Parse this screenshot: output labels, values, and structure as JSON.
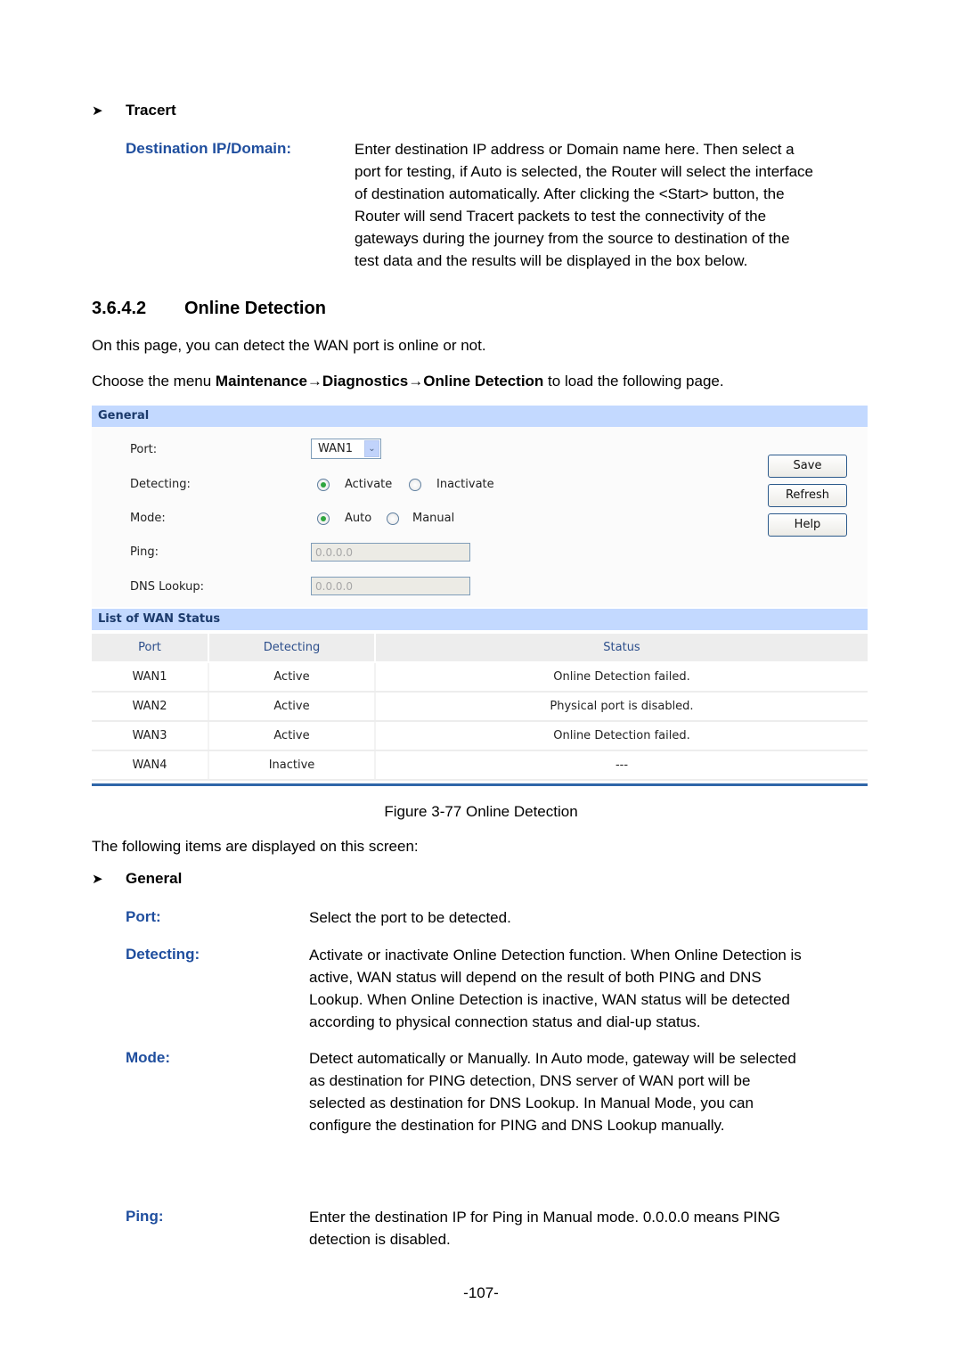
{
  "tracert": {
    "bullet": "Tracert",
    "items": [
      {
        "term": "Destination IP/Domain:",
        "lines": [
          "Enter destination IP address or Domain name here. Then select a",
          "port for testing, if Auto is selected, the Router will select the interface",
          "of destination automatically. After clicking the <Start> button, the",
          "Router will send Tracert packets to test the connectivity of the",
          "gateways during the journey from the source to destination of the",
          "test data and the results will be displayed in the box below."
        ]
      }
    ]
  },
  "section": {
    "number": "3.6.4.2",
    "title": "Online Detection",
    "intro": "On this page, you can detect the WAN port is online or not.",
    "menu_prefix": "Choose the menu ",
    "menu_path": "Maintenance→Diagnostics→Online Detection",
    "menu_suffix": " to load the following page."
  },
  "ui": {
    "general_title": "General",
    "fields": {
      "port_label": "Port:",
      "port_value": "WAN1",
      "detecting_label": "Detecting:",
      "detecting_options": [
        "Activate",
        "Inactivate"
      ],
      "detecting_selected": "Activate",
      "mode_label": "Mode:",
      "mode_options": [
        "Auto",
        "Manual"
      ],
      "mode_selected": "Auto",
      "ping_label": "Ping:",
      "ping_value": "0.0.0.0",
      "dns_label": "DNS Lookup:",
      "dns_value": "0.0.0.0"
    },
    "buttons": {
      "save": "Save",
      "refresh": "Refresh",
      "help": "Help"
    },
    "list_title": "List of WAN Status",
    "table": {
      "headers": [
        "Port",
        "Detecting",
        "Status"
      ],
      "rows": [
        [
          "WAN1",
          "Active",
          "Online Detection failed."
        ],
        [
          "WAN2",
          "Active",
          "Physical port is disabled."
        ],
        [
          "WAN3",
          "Active",
          "Online Detection failed."
        ],
        [
          "WAN4",
          "Inactive",
          "---"
        ]
      ]
    }
  },
  "figure_caption": "Figure 3-77 Online Detection",
  "items_intro": "The following items are displayed on this screen:",
  "general": {
    "bullet": "General",
    "items": [
      {
        "term": "Port:",
        "text": "Select the port to be detected."
      },
      {
        "term": "Detecting:",
        "lines": [
          "Activate or inactivate Online Detection function. When Online Detection is",
          "active, WAN status will depend on the result of both PING and DNS",
          "Lookup. When Online Detection is inactive, WAN status will be detected",
          "according to physical connection status and dial-up status."
        ]
      },
      {
        "term": "Mode:",
        "lines": [
          "Detect automatically or Manually. In Auto mode, gateway will be selected",
          "as destination for PING detection, DNS server of WAN port will be",
          "selected as destination for DNS Lookup. In Manual Mode, you can",
          "configure the destination for PING and DNS Lookup manually."
        ]
      },
      {
        "term": "Ping:",
        "lines": [
          "Enter the destination IP for Ping in Manual mode. 0.0.0.0 means PING",
          "detection is disabled."
        ]
      }
    ]
  },
  "page_number": "-107-",
  "colors": {
    "term_blue": "#1f4e9e",
    "ui_header_bar": "#c3d9ff",
    "ui_header_text": "#1b3a6b",
    "table_header_text": "#2d4f8c",
    "rule_blue": "#2f66a8"
  }
}
